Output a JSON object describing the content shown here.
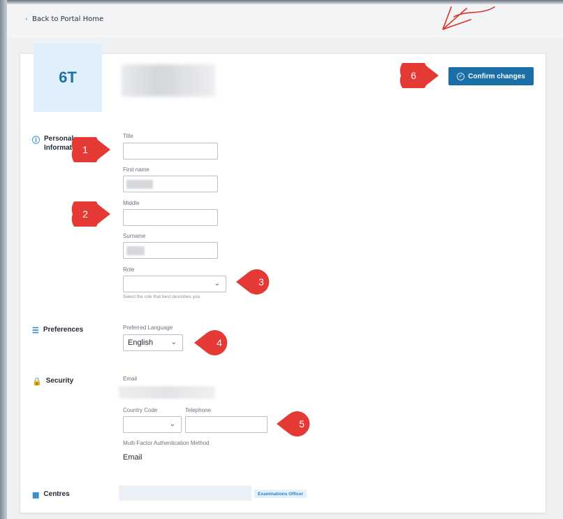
{
  "nav": {
    "back_label": "Back to Portal Home"
  },
  "profile": {
    "initials": "6T"
  },
  "actions": {
    "confirm_label": "Confirm changes"
  },
  "sections": {
    "personal": "Personal Information",
    "preferences": "Preferences",
    "security": "Security",
    "centres": "Centres"
  },
  "fields": {
    "title_label": "Title",
    "first_name_label": "First name",
    "middle_label": "Middle",
    "surname_label": "Surname",
    "role_label": "Role",
    "role_hint": "Select the role that best describes you",
    "preferred_language_label": "Preferred Language",
    "preferred_language_value": "English",
    "email_label": "Email",
    "country_code_label": "Country Code",
    "telephone_label": "Telephone",
    "mfa_label": "Multi-Factor Authentication Method",
    "mfa_value": "Email"
  },
  "centres": {
    "role_badge": "Examinations Officer"
  },
  "annotations": [
    "1",
    "2",
    "3",
    "4",
    "5",
    "6"
  ],
  "colors": {
    "accent": "#1b6fa6",
    "marker": "#e53935",
    "avatar_bg": "#dff0fb"
  }
}
